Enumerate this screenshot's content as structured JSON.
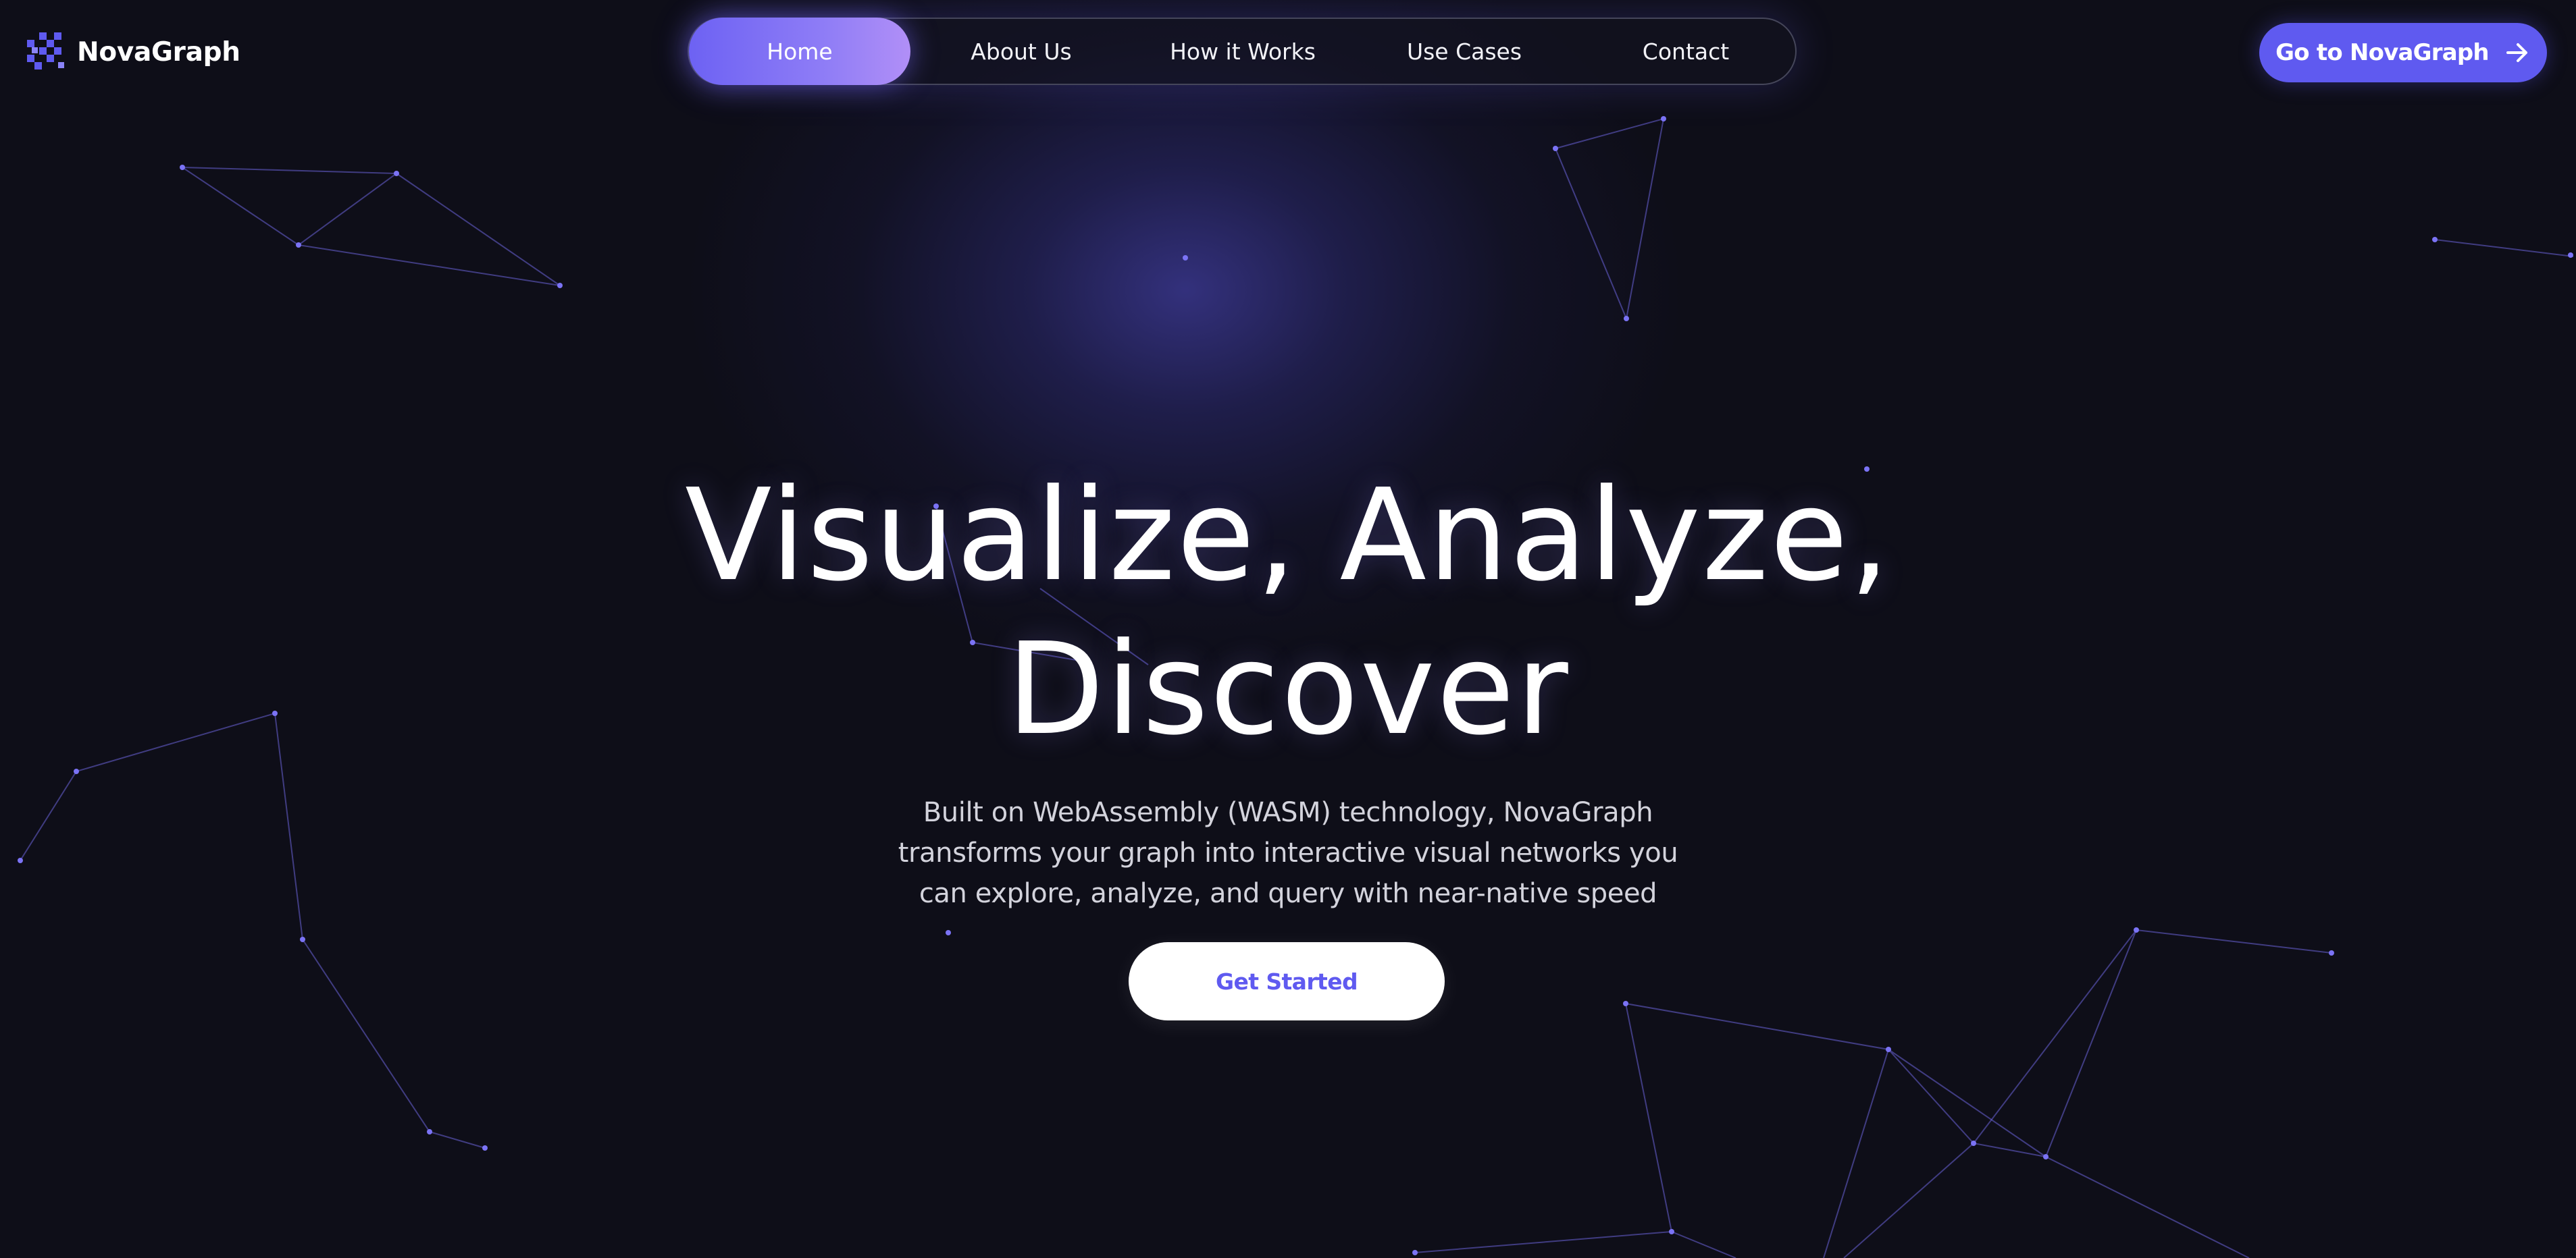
{
  "brand": {
    "name": "NovaGraph",
    "logo_icon": "grid-squares-logo-icon",
    "accent_color": "#5f5af0"
  },
  "nav": {
    "items": [
      {
        "label": "Home",
        "active": true
      },
      {
        "label": "About Us",
        "active": false
      },
      {
        "label": "How it Works",
        "active": false
      },
      {
        "label": "Use Cases",
        "active": false
      },
      {
        "label": "Contact",
        "active": false
      }
    ],
    "active_gradient": [
      "#6d62f3",
      "#b18ff7"
    ]
  },
  "cta": {
    "label": "Go to NovaGraph",
    "icon": "arrow-right-icon",
    "color": "#5f5af0"
  },
  "hero": {
    "title_line1": "Visualize, Analyze,",
    "title_line2": "Discover",
    "subtitle_line1": "Built on WebAssembly (WASM) technology, NovaGraph",
    "subtitle_line2": "transforms your graph into interactive visual networks you",
    "subtitle_line3": "can explore, analyze, and query with near-native speed",
    "button_label": "Get Started",
    "background_color": "#0e0e18",
    "glow_color": "#4a46ba"
  },
  "background": {
    "decoration": "network-constellation",
    "node_color": "#7b73f5",
    "edge_color": "#6a63d8"
  }
}
